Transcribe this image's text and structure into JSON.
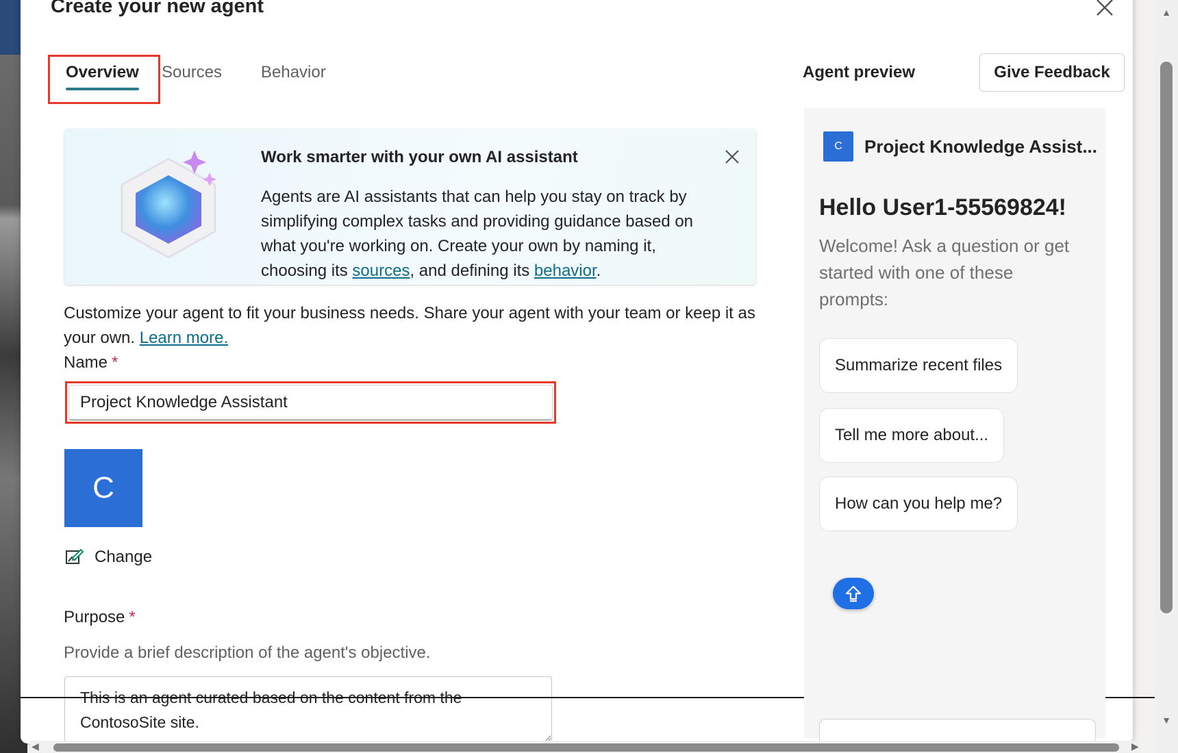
{
  "dialog": {
    "title": "Create your new agent",
    "close_icon": "close-icon"
  },
  "tabs": [
    {
      "label": "Overview",
      "active": true
    },
    {
      "label": "Sources",
      "active": false
    },
    {
      "label": "Behavior",
      "active": false
    }
  ],
  "banner": {
    "title": "Work smarter with your own AI assistant",
    "text_before": "Agents are AI assistants that can help you stay on track by simplifying complex tasks and providing guidance based on what you're working on. Create your own by naming it, choosing its ",
    "link_sources": "sources",
    "text_middle": ", and defining its ",
    "link_behavior": "behavior",
    "text_after": "."
  },
  "intro": {
    "text": "Customize your agent to fit your business needs. Share your agent with your team or keep it as your own. ",
    "link": "Learn more."
  },
  "name_field": {
    "label": "Name",
    "required_mark": "*",
    "value": "Project Knowledge Assistant"
  },
  "icon_section": {
    "avatar_letter": "C",
    "avatar_color": "#2b6fd6",
    "change_label": "Change"
  },
  "purpose_field": {
    "label": "Purpose",
    "required_mark": "*",
    "help": "Provide a brief description of the agent's objective.",
    "value": "This is an agent curated based on the content from the ContosoSite site."
  },
  "preview": {
    "label": "Agent preview",
    "feedback_button": "Give Feedback",
    "agent_letter": "C",
    "agent_name": "Project Knowledge Assist...",
    "greeting": "Hello User1-55569824!",
    "welcome": "Welcome! Ask a question or get started with one of these prompts:",
    "prompts": [
      "Summarize recent files",
      "Tell me more about...",
      "How can you help me?"
    ]
  },
  "colors": {
    "accent": "#2b7a8a",
    "highlight": "#e5392a",
    "link": "#0e6e8a",
    "required": "#c4314b",
    "avatar": "#2b6fd6"
  }
}
